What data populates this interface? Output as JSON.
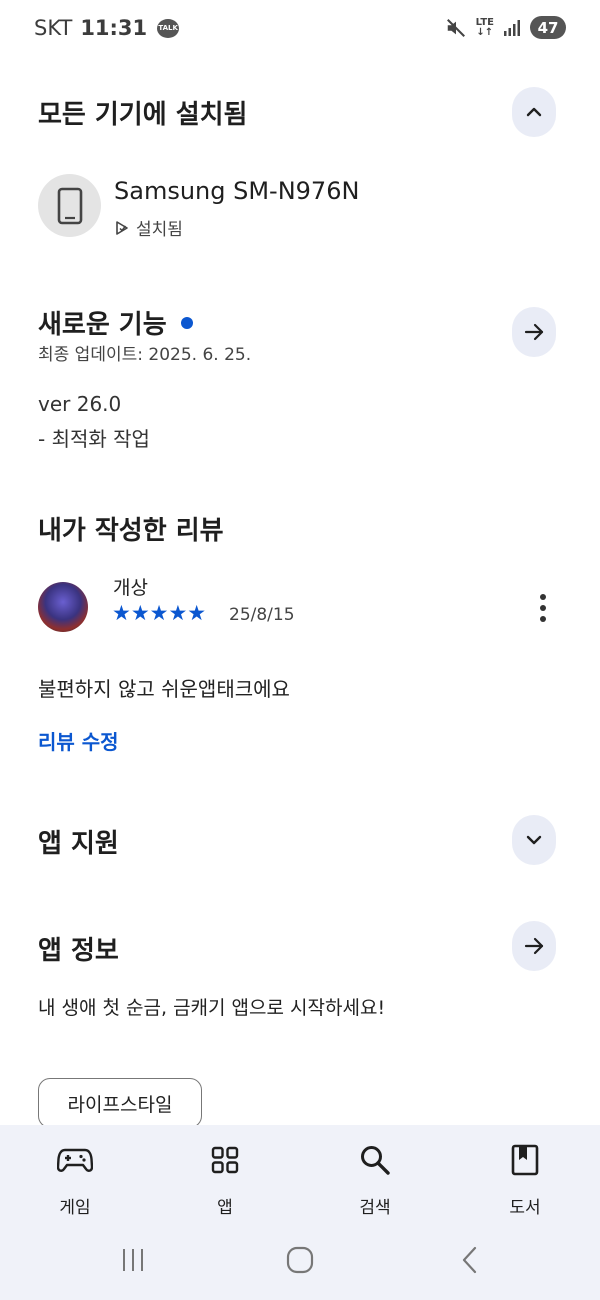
{
  "status_bar": {
    "carrier": "SKT",
    "time": "11:31",
    "talk_badge": "TALK",
    "network": "LTE",
    "battery": "47"
  },
  "installed": {
    "title": "모든 기기에 설치됨",
    "device_name": "Samsung SM-N976N",
    "device_status": "설치됨"
  },
  "whats_new": {
    "title": "새로운 기능",
    "updated": "최종 업데이트: 2025. 6. 25.",
    "lines": [
      "ver 26.0",
      "- 최적화 작업"
    ]
  },
  "my_review": {
    "title": "내가 작성한 리뷰",
    "reviewer": "개상",
    "stars": "★★★★★",
    "rating": 5,
    "date": "25/8/15",
    "text": "불편하지 않고 쉬운앱태크에요",
    "edit_label": "리뷰 수정"
  },
  "app_support": {
    "title": "앱 지원"
  },
  "app_info": {
    "title": "앱 정보",
    "description": "내 생애 첫 순금, 금캐기 앱으로 시작하세요!",
    "category_chip": "라이프스타일"
  },
  "bottom_nav": {
    "items": [
      {
        "label": "게임",
        "icon": "gamepad-icon"
      },
      {
        "label": "앱",
        "icon": "apps-grid-icon"
      },
      {
        "label": "검색",
        "icon": "search-icon"
      },
      {
        "label": "도서",
        "icon": "book-icon"
      }
    ]
  },
  "colors": {
    "accent_blue": "#0b57d0",
    "button_bg": "#e9ecf6",
    "nav_bg": "#f0f2f9"
  }
}
